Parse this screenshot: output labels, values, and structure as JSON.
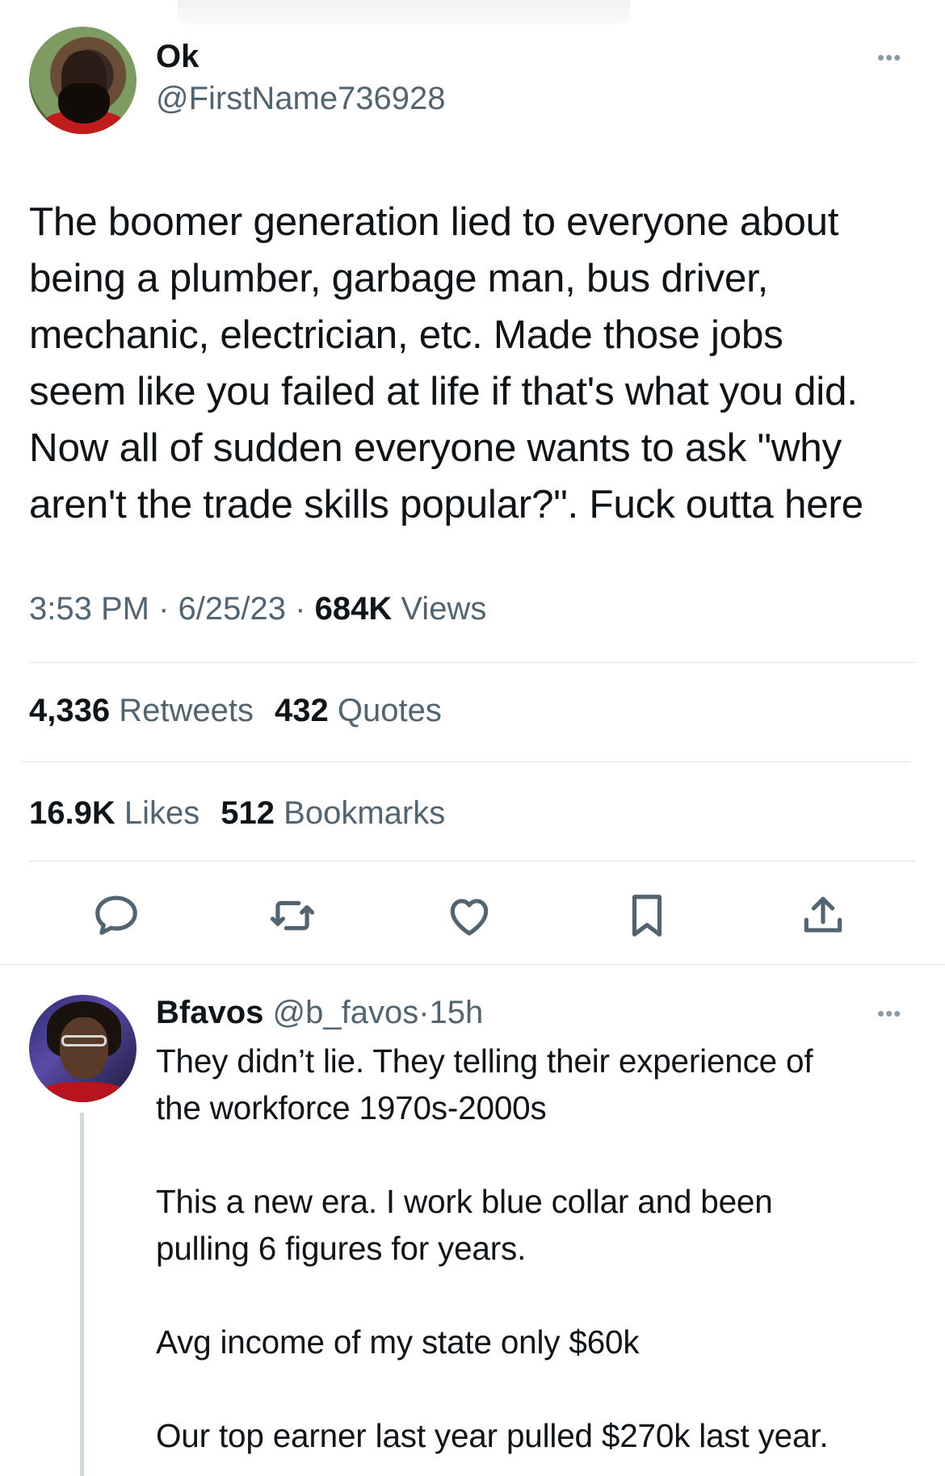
{
  "tweet": {
    "display_name": "Ok",
    "handle": "@FirstName736928",
    "text": "The boomer generation lied to everyone about\nbeing a plumber, garbage man, bus driver,\nmechanic, electrician, etc. Made those jobs\nseem like you failed at life if that's what you did.\nNow all of sudden everyone wants to ask \"why\naren't the trade skills popular?\". Fuck outta here",
    "time": "3:53 PM",
    "date": "6/25/23",
    "separator": "·",
    "views_count": "684K",
    "views_label": "Views",
    "retweets_count": "4,336",
    "retweets_label": "Retweets",
    "quotes_count": "432",
    "quotes_label": "Quotes",
    "likes_count": "16.9K",
    "likes_label": "Likes",
    "bookmarks_count": "512",
    "bookmarks_label": "Bookmarks",
    "more_glyph": "•••"
  },
  "actions": {
    "icons": [
      "reply-icon",
      "retweet-icon",
      "like-icon",
      "bookmark-icon",
      "share-icon"
    ]
  },
  "reply": {
    "display_name": "Bfavos",
    "handle": "@b_favos",
    "separator": "·",
    "age": "15h",
    "text": "They didn’t lie. They telling their experience of\nthe workforce 1970s-2000s\n\nThis a new era. I work blue collar and been\npulling 6 figures for years.\n\nAvg income of my state only $60k\n\nOur top earner last year pulled $270k last year.",
    "more_glyph": "•••"
  },
  "colors": {
    "text": "#0f1419",
    "secondary": "#536471",
    "divider": "#e1e4e7",
    "thread_line": "#cfd9de"
  }
}
